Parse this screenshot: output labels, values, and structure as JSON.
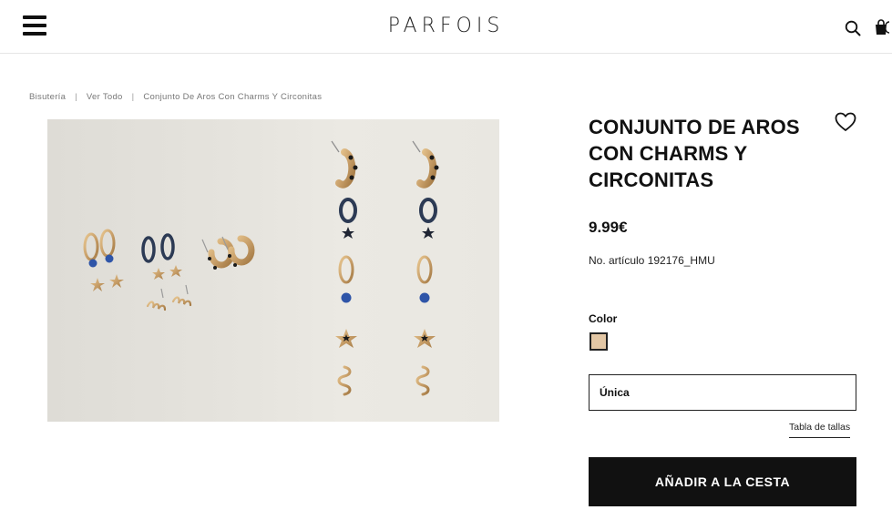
{
  "header": {
    "logo": "PARFOIS",
    "menu_icon": "hamburger-icon",
    "search_icon": "search-icon",
    "cart_icon": "bag-icon"
  },
  "breadcrumb": [
    "Bisutería",
    "Ver Todo",
    "Conjunto De Aros Con Charms Y Circonitas"
  ],
  "product": {
    "title": "CONJUNTO DE AROS CON CHARMS Y CIRCONITAS",
    "price": "9.99€",
    "article_number": "No. artículo 192176_HMU",
    "color_label": "Color",
    "selected_color": "#e3c7a5",
    "size_value": "Única",
    "size_guide_label": "Tabla de tallas",
    "add_to_cart_label": "AÑADIR A LA CESTA",
    "wishlist_icon": "heart-icon"
  },
  "colors": {
    "gold": "#c9a06a",
    "navy": "#2c3a54",
    "blue_stone": "#2f55a8",
    "button_bg": "#111111"
  }
}
